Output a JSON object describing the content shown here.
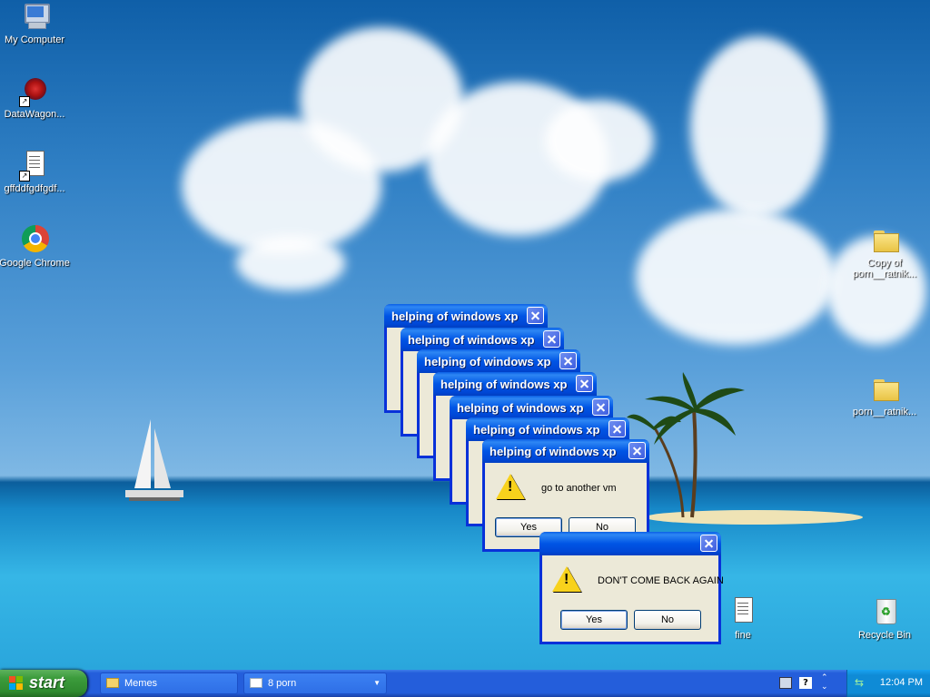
{
  "desktop": {
    "icons": [
      {
        "label": "My Computer",
        "icon": "my-computer-icon"
      },
      {
        "label": "DataWagon...",
        "icon": "datawagon-shortcut-icon"
      },
      {
        "label": "gffddfgdfgdf...",
        "icon": "text-file-shortcut-icon"
      },
      {
        "label": "Google Chrome",
        "icon": "chrome-icon"
      },
      {
        "label": "Copy of porn__ratnik...",
        "icon": "folder-icon"
      },
      {
        "label": "porn__ratnik...",
        "icon": "folder-icon"
      },
      {
        "label": "fine",
        "icon": "text-file-icon"
      },
      {
        "label": "Recycle Bin",
        "icon": "recycle-bin-icon"
      }
    ]
  },
  "dialogs": {
    "stack_title": "helping of windows xp",
    "front": {
      "title": "helping of windows xp",
      "message": "go to another vm",
      "yes": "Yes",
      "no": "No",
      "icon": "warning-icon"
    },
    "last": {
      "title": "",
      "message": "DON'T COME BACK AGAIN",
      "yes": "Yes",
      "no": "No",
      "icon": "warning-icon"
    }
  },
  "taskbar": {
    "start_label": "start",
    "buttons": [
      {
        "label": "Memes",
        "icon": "folder-icon"
      },
      {
        "label": "8 porn",
        "icon": "window-group-icon"
      }
    ],
    "clock": "12:04 PM"
  }
}
